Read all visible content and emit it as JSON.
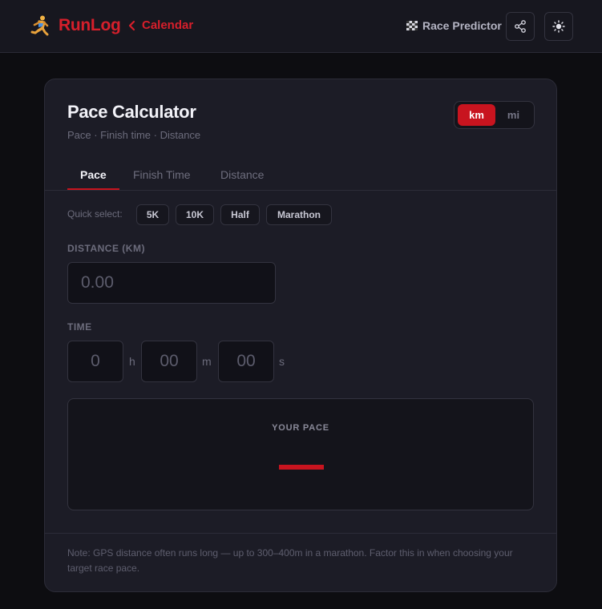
{
  "header": {
    "logo": "RunLog",
    "back_link": "Calendar",
    "race_predictor": "Race Predictor",
    "icons": [
      "runner-icon",
      "chevron-left-icon",
      "checkered-flag-icon",
      "share-icon",
      "sun-icon"
    ]
  },
  "calculator": {
    "title": "Pace Calculator",
    "subtitle": "Pace · Finish time · Distance",
    "unit_toggle": {
      "options": [
        "km",
        "mi"
      ],
      "selected": "km"
    },
    "tabs": [
      "Pace",
      "Finish Time",
      "Distance"
    ],
    "active_tab": "Pace",
    "quick_select": {
      "label": "Quick select:",
      "options": [
        "5K",
        "10K",
        "Half",
        "Marathon"
      ]
    },
    "distance": {
      "label": "DISTANCE (KM)",
      "placeholder": "0.00"
    },
    "time": {
      "label": "TIME",
      "hours_placeholder": "0",
      "minutes_placeholder": "00",
      "seconds_placeholder": "00",
      "hours_unit": "h",
      "minutes_unit": "m",
      "seconds_unit": "s"
    },
    "result": {
      "label": "YOUR PACE",
      "value": ""
    },
    "note": "Note: GPS distance often runs long — up to 300–400m in a marathon. Factor this in when choosing your target race pace."
  },
  "colors": {
    "accent": "#c8141f",
    "background": "#0d0d11",
    "card": "#1c1c26"
  }
}
